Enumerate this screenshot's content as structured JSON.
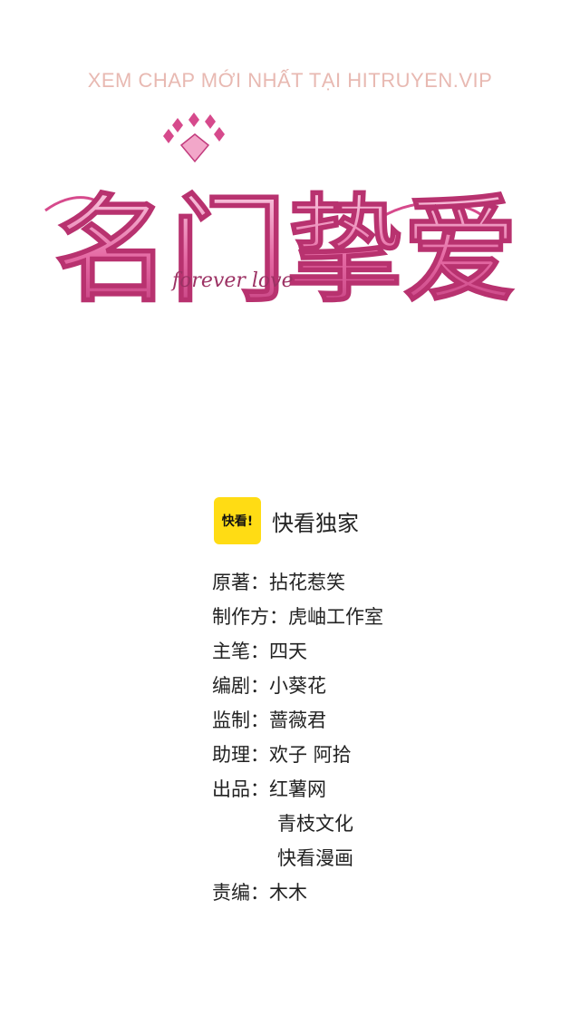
{
  "watermark": "XEM CHAP MỚI NHẤT TẠI HITRUYEN.VIP",
  "logo": {
    "title": "名门挚爱",
    "subtitle": "forever love"
  },
  "badge": {
    "icon_text": "快看!",
    "label": "快看独家"
  },
  "credits": [
    {
      "role": "原著：",
      "value": "拈花惹笑"
    },
    {
      "role": "制作方：",
      "value": "虎岫工作室"
    },
    {
      "role": "主笔：",
      "value": "四天"
    },
    {
      "role": "编剧：",
      "value": "小葵花"
    },
    {
      "role": "监制：",
      "value": "蔷薇君"
    },
    {
      "role": "助理：",
      "value": "欢子 阿拾"
    },
    {
      "role": "出品：",
      "value": "红薯网"
    },
    {
      "role": "",
      "value": "青枝文化"
    },
    {
      "role": "",
      "value": "快看漫画"
    },
    {
      "role": "责编：",
      "value": "木木"
    }
  ],
  "colors": {
    "watermark": "#e8b9b2",
    "logo_light": "#f7c4dc",
    "logo_dark": "#d64a8c",
    "badge_bg": "#ffdc14"
  }
}
